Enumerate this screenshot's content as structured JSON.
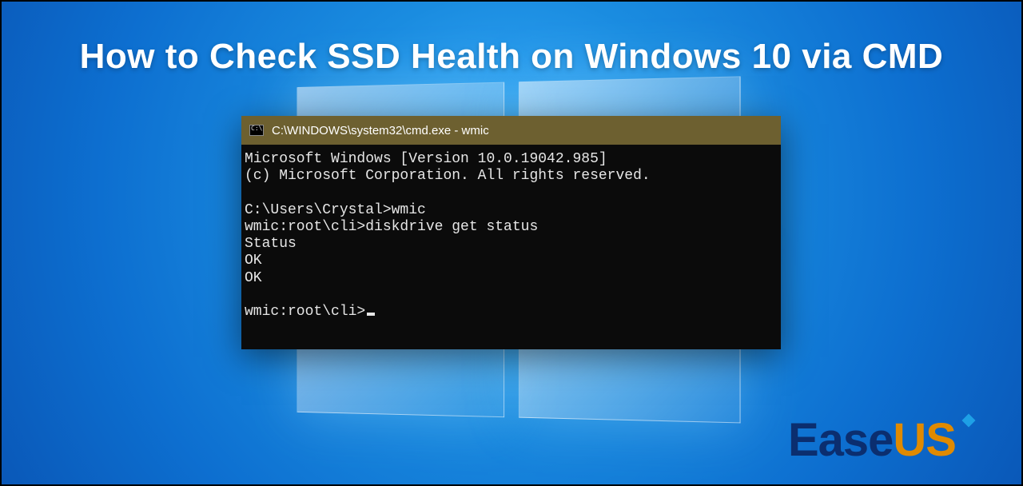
{
  "heading": "How to Check SSD Health on Windows 10 via CMD",
  "cmd": {
    "title": "C:\\WINDOWS\\system32\\cmd.exe - wmic",
    "lines": [
      "Microsoft Windows [Version 10.0.19042.985]",
      "(c) Microsoft Corporation. All rights reserved.",
      "",
      "C:\\Users\\Crystal>wmic",
      "wmic:root\\cli>diskdrive get status",
      "Status",
      "OK",
      "OK",
      "",
      "wmic:root\\cli>"
    ]
  },
  "brand": {
    "part1": "Ease",
    "part2": "US"
  }
}
